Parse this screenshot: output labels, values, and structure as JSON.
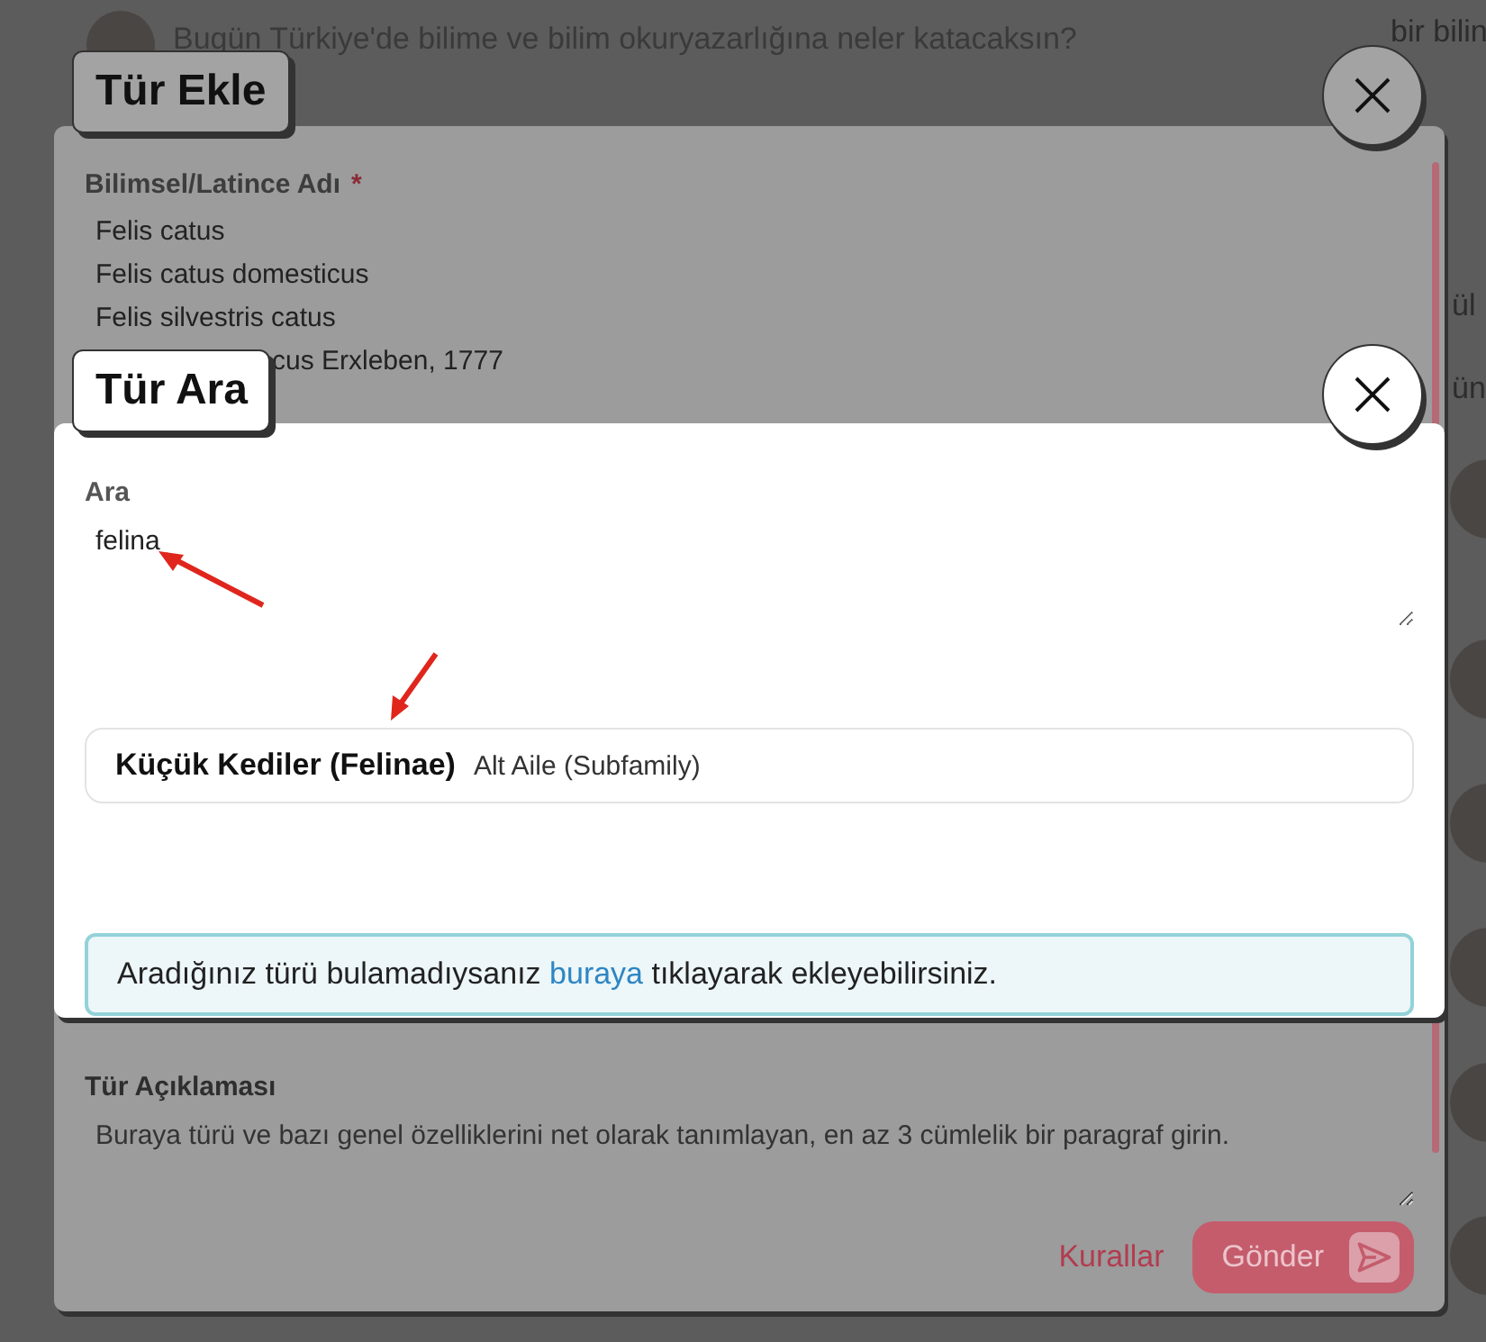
{
  "background": {
    "question": "Bugün Türkiye'de bilime ve bilim okuryazarlığına neler katacaksın?",
    "side_texts": [
      "bir bilin",
      "ül",
      "ün"
    ]
  },
  "add_dialog": {
    "title": "Tür Ekle",
    "name_label": "Bilimsel/Latince Adı",
    "required_mark": "*",
    "names": [
      "Felis catus",
      "Felis catus domesticus",
      "Felis silvestris catus",
      "cus Erxleben, 1777"
    ],
    "description_label": "Tür Açıklaması",
    "description_placeholder": "Buraya türü ve bazı genel özelliklerini net olarak tanımlayan, en az 3 cümlelik bir paragraf girin.",
    "rules_link": "Kurallar",
    "submit": "Gönder"
  },
  "search_dialog": {
    "title": "Tür Ara",
    "search_label": "Ara",
    "search_value": "felina",
    "results": [
      {
        "name": "Küçük Kediler (Felinae)",
        "rank": "Alt Aile (Subfamily)"
      }
    ],
    "notice": {
      "before": "Aradığınız türü bulamadıysanız ",
      "link": "buraya",
      "after": " tıklayarak ekleyebilirsiniz."
    }
  }
}
